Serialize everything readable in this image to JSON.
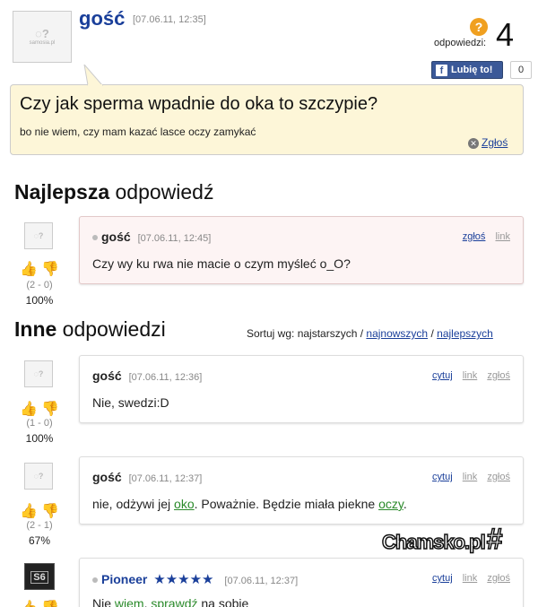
{
  "question": {
    "author": "gość",
    "timestamp": "[07.06.11, 12:35]",
    "avatar_site": "samosia.pl",
    "answers_label": "odpowiedzi:",
    "answers_count": "4",
    "like_label": "Lubię to!",
    "like_count": "0",
    "title": "Czy jak sperma wpadnie do oka to szczypie?",
    "body": "bo nie wiem, czy mam kazać lasce oczy zamykać",
    "report_label": "Zgłoś"
  },
  "best": {
    "heading_bold": "Najlepsza",
    "heading_rest": " odpowiedź",
    "answer": {
      "author": "gość",
      "timestamp": "[07.06.11, 12:45]",
      "report": "zgłoś",
      "link": "link",
      "text": "Czy wy ku rwa nie macie o czym myśleć o_O?",
      "votes": "(2 - 0)",
      "percent": "100%"
    }
  },
  "others": {
    "heading_bold": "Inne",
    "heading_rest": " odpowiedzi",
    "sort_label": "Sortuj wg: najstarszych /",
    "sort_newest": "najnowszych",
    "sort_sep": "/",
    "sort_best": "najlepszych",
    "answers": [
      {
        "author": "gość",
        "timestamp": "[07.06.11, 12:36]",
        "quote": "cytuj",
        "link": "link",
        "report": "zgłoś",
        "text": "Nie, swedzi:D",
        "votes": "(1 - 0)",
        "percent": "100%"
      },
      {
        "author": "gość",
        "timestamp": "[07.06.11, 12:37]",
        "quote": "cytuj",
        "link": "link",
        "report": "zgłoś",
        "text_1": "nie, odżywi jej ",
        "text_link_1": "oko",
        "text_2": ". Poważnie. Będzie miała piekne ",
        "text_link_2": "oczy",
        "text_3": ".",
        "votes": "(2 - 1)",
        "percent": "67%"
      },
      {
        "author": "Pioneer",
        "stars": "★★★★★",
        "timestamp": "[07.06.11, 12:37]",
        "quote": "cytuj",
        "link": "link",
        "report": "zgłoś",
        "text_1": "Nie ",
        "text_link_1": "wiem",
        "text_2": ", ",
        "text_link_2": "sprawdź",
        "text_3": " na sobie",
        "avatar_text": "S6"
      }
    ]
  },
  "watermark": "Chamsko.pl",
  "colors": {
    "question_bg": "#fdf6d8",
    "best_bg": "#fdf4f4",
    "link": "#1a3f9a",
    "green_link": "#2a8a2a",
    "answer_badge": "#f0a020",
    "facebook": "#3b5998"
  },
  "icons": [
    "question-badge-icon",
    "facebook-icon",
    "report-icon",
    "thumbs-up-icon",
    "thumbs-down-icon",
    "rating-stars-icon"
  ]
}
